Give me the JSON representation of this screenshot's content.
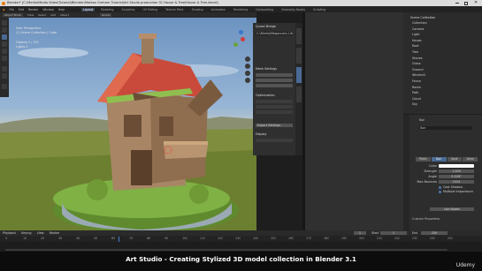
{
  "window": {
    "title": "Blender* [C:\\Media\\Media Video\\Tutorial\\Blender\\Mofasa Graham Tutorial\\Art Studio production 01 House & Tree\\House & Tree.blend]"
  },
  "menu": [
    "File",
    "Edit",
    "Render",
    "Window",
    "Help"
  ],
  "workspaces": [
    "Layout",
    "Modeling",
    "Sculpting",
    "UV Editing",
    "Texture Paint",
    "Shading",
    "Animation",
    "Rendering",
    "Compositing",
    "Geometry Nodes",
    "Scripting"
  ],
  "active_workspace": "Layout",
  "viewport_header": {
    "mode": "Object Mode",
    "items": [
      "View",
      "Select",
      "Add",
      "Object"
    ],
    "orientation": "Global"
  },
  "viewport_overlay": {
    "title": "User Perspective",
    "collection": "(1) Scene Collection | Cube",
    "stats": [
      "Objects 1 / 102",
      "Lights 2"
    ]
  },
  "pref_panel": {
    "title": "Quixel Bridge",
    "path": "C:\\Media\\Megascans Library\\Downloaded",
    "sections": [
      "Mesh Settings",
      "Optimization",
      "Display"
    ],
    "export": "Export Settings"
  },
  "outliner": {
    "header": "Scene Collection",
    "items": [
      "Collection",
      "Camera",
      "Light",
      "House",
      "Roof",
      "Tree",
      "Stones",
      "Grass",
      "Ground",
      "Windmill",
      "Fence",
      "Rocks",
      "Path",
      "Cloud",
      "Sky"
    ]
  },
  "properties": {
    "tabs": [
      "Point",
      "Sun",
      "Spot",
      "Area"
    ],
    "active_tab": "Sun",
    "object_name": "Sun",
    "light_fields": [
      "Color",
      "Strength",
      "Angle",
      "Max Bounces"
    ],
    "light_values": [
      "",
      "1.000",
      "0.526°",
      "1024"
    ],
    "checks": [
      "Cast Shadow",
      "Multiple Importance"
    ],
    "nodes_button": "Use Nodes",
    "custom": "Custom Properties"
  },
  "timeline": {
    "menu": [
      "Playback",
      "Keying",
      "View",
      "Marker"
    ],
    "start_label": "Start",
    "start": "1",
    "end_label": "End",
    "end": "250",
    "current": "1",
    "ticks": [
      "0",
      "10",
      "20",
      "30",
      "40",
      "50",
      "60",
      "70",
      "80",
      "90",
      "100",
      "110",
      "120",
      "130",
      "140",
      "150",
      "160",
      "170",
      "180",
      "190",
      "200",
      "210",
      "220",
      "230",
      "240",
      "250"
    ]
  },
  "caption": "Art Studio - Creating Stylized 3D model collection in Blender 3.1",
  "brand": "Udemy"
}
